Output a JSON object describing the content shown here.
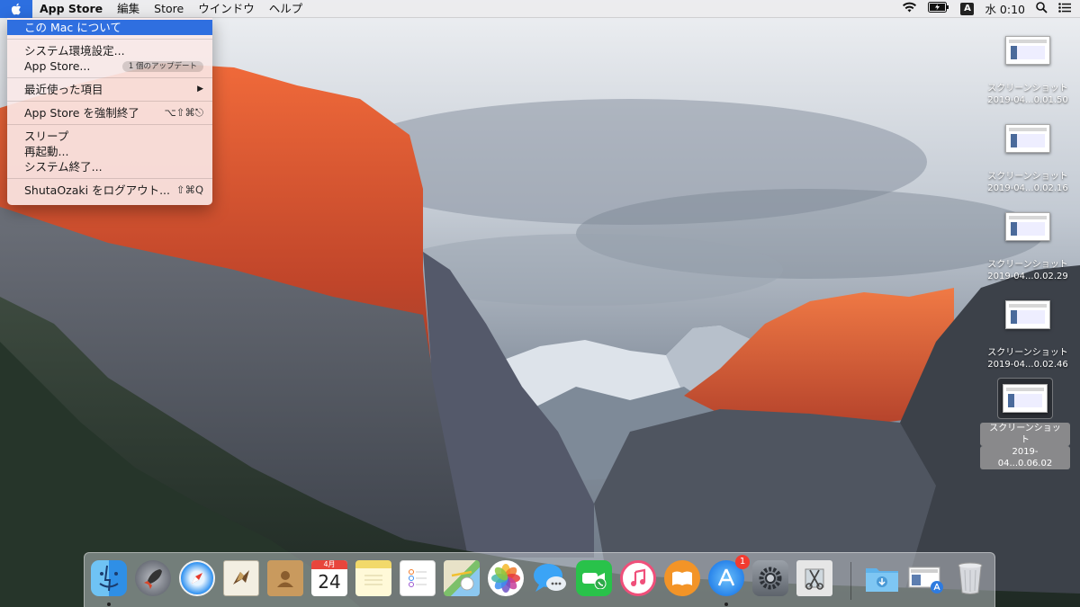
{
  "menubar": {
    "app_name": "App Store",
    "menus": [
      "編集",
      "Store",
      "ウインドウ",
      "ヘルプ"
    ],
    "status": {
      "input_method": "A",
      "clock": "水 0:10"
    }
  },
  "apple_menu": {
    "about": "この Mac について",
    "system_prefs": "システム環境設定...",
    "app_store": "App Store...",
    "updates_badge": "1 個のアップデート",
    "recent_items": "最近使った項目",
    "force_quit": "App Store を強制終了",
    "force_quit_shortcut": "⌥⇧⌘⎋",
    "sleep": "スリープ",
    "restart": "再起動...",
    "shutdown": "システム終了...",
    "logout": "ShutaOzaki をログアウト...",
    "logout_shortcut": "⇧⌘Q"
  },
  "desktop_files": [
    {
      "name": "スクリーンショット",
      "date": "2019-04...0.01.50"
    },
    {
      "name": "スクリーンショット",
      "date": "2019-04...0.02.16"
    },
    {
      "name": "スクリーンショット",
      "date": "2019-04...0.02.29"
    },
    {
      "name": "スクリーンショット",
      "date": "2019-04...0.02.46"
    },
    {
      "name": "スクリーンショット",
      "date": "2019-04...0.06.02"
    }
  ],
  "dock": {
    "calendar_month": "4月",
    "calendar_day": "24",
    "app_store_badge": "1",
    "icons": [
      "finder-icon",
      "launchpad-icon",
      "safari-icon",
      "mail-icon",
      "contacts-icon",
      "calendar-icon",
      "notes-icon",
      "reminders-icon",
      "maps-icon",
      "photos-icon",
      "messages-icon",
      "facetime-icon",
      "itunes-icon",
      "ibooks-icon",
      "app-store-icon",
      "system-preferences-icon",
      "preview-icon",
      "downloads-icon",
      "document-folder-icon",
      "trash-icon"
    ]
  },
  "colors": {
    "highlight": "#2f6fe0",
    "badge_red": "#f23b30"
  }
}
